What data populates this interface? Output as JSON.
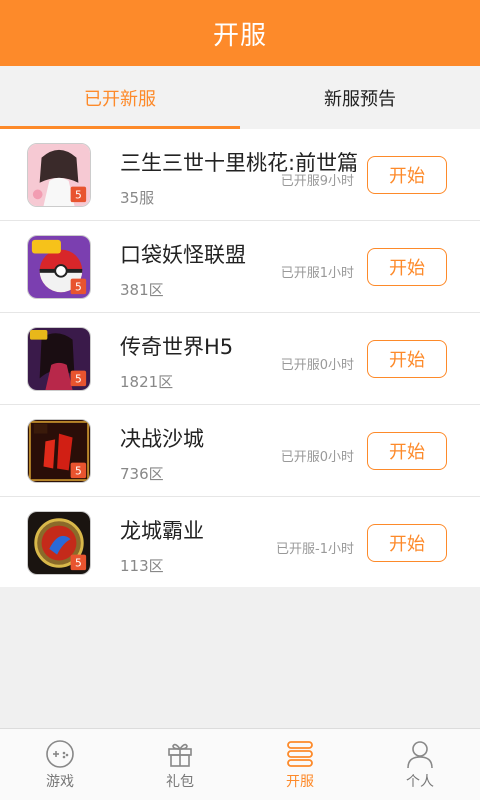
{
  "header": {
    "title": "开服"
  },
  "tabs": [
    {
      "label": "已开新服",
      "active": true
    },
    {
      "label": "新服预告",
      "active": false
    }
  ],
  "games": [
    {
      "name": "三生三世十里桃花:前世篇",
      "server": "35服",
      "open_time": "已开服9小时",
      "button": "开始",
      "icon": "game-icon-sansheng"
    },
    {
      "name": "口袋妖怪联盟",
      "server": "381区",
      "open_time": "已开服1小时",
      "button": "开始",
      "icon": "game-icon-pokemon"
    },
    {
      "name": "传奇世界H5",
      "server": "1821区",
      "open_time": "已开服0小时",
      "button": "开始",
      "icon": "game-icon-chuanqi"
    },
    {
      "name": "决战沙城",
      "server": "736区",
      "open_time": "已开服0小时",
      "button": "开始",
      "icon": "game-icon-shacheng"
    },
    {
      "name": "龙城霸业",
      "server": "113区",
      "open_time": "已开服-1小时",
      "button": "开始",
      "icon": "game-icon-longcheng"
    }
  ],
  "bottom_nav": [
    {
      "label": "游戏",
      "icon": "gamepad-icon",
      "active": false
    },
    {
      "label": "礼包",
      "icon": "gift-icon",
      "active": false
    },
    {
      "label": "开服",
      "icon": "server-stack-icon",
      "active": true
    },
    {
      "label": "个人",
      "icon": "user-icon",
      "active": false
    }
  ],
  "colors": {
    "accent": "#fd8a2a",
    "background": "#f0f0f0",
    "text": "#222222",
    "muted": "#888888"
  }
}
